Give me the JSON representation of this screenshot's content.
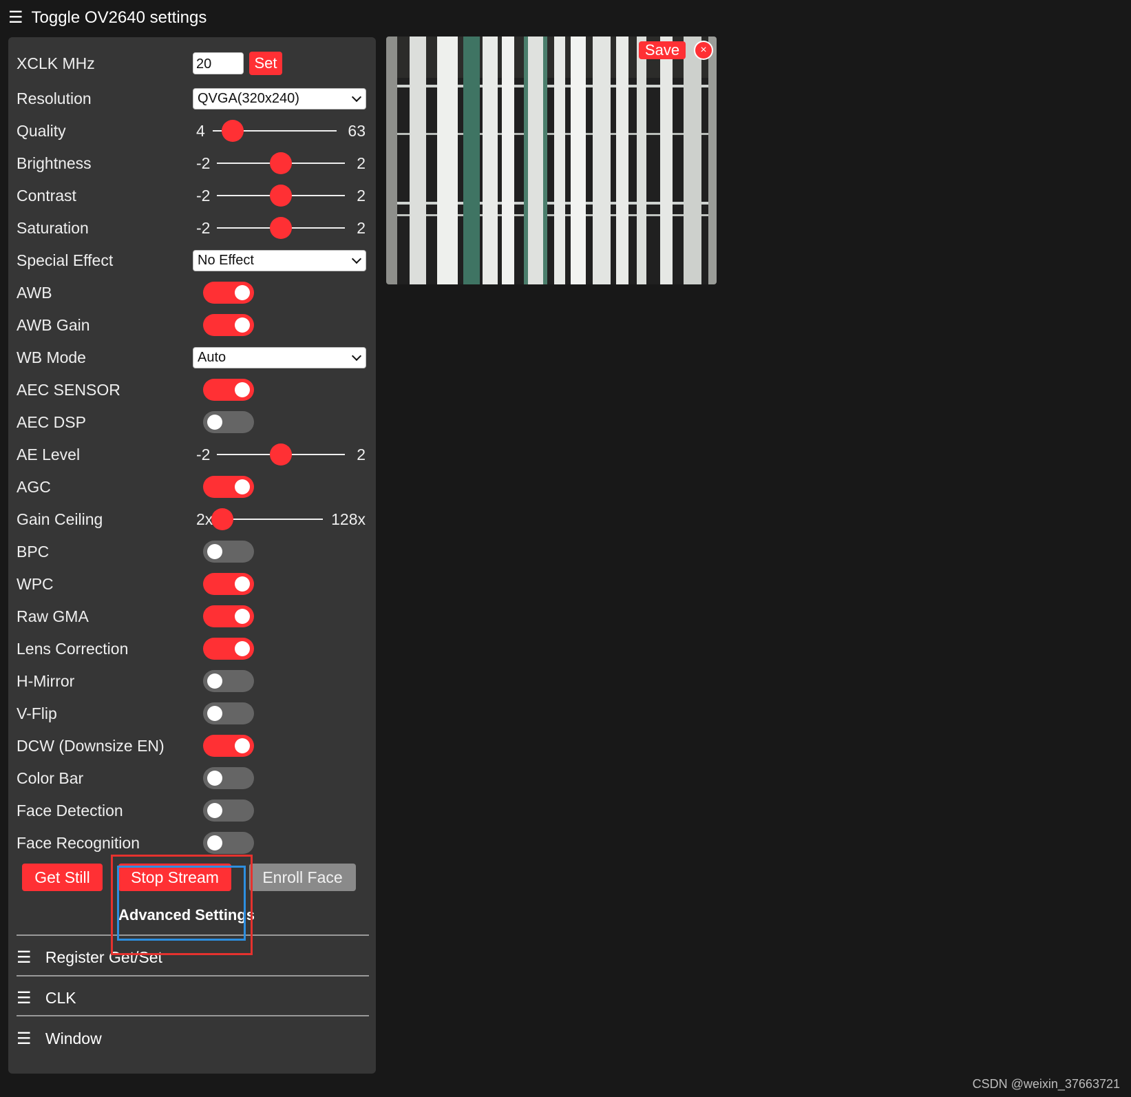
{
  "header": {
    "menu_icon": "☰",
    "title": "Toggle OV2640 settings"
  },
  "colors": {
    "accent": "#ff3034",
    "panel": "#363636",
    "background": "#181818",
    "toggle_off": "#656565"
  },
  "controls": {
    "xclk": {
      "label": "XCLK MHz",
      "value": "20",
      "button": "Set"
    },
    "resolution": {
      "label": "Resolution",
      "selected": "QVGA(320x240)"
    },
    "quality": {
      "label": "Quality",
      "min": "4",
      "max": "63",
      "level": 0.16
    },
    "brightness": {
      "label": "Brightness",
      "min": "-2",
      "max": "2",
      "level": 0.5
    },
    "contrast": {
      "label": "Contrast",
      "min": "-2",
      "max": "2",
      "level": 0.5
    },
    "saturation": {
      "label": "Saturation",
      "min": "-2",
      "max": "2",
      "level": 0.5
    },
    "special_effect": {
      "label": "Special Effect",
      "selected": "No Effect"
    },
    "awb": {
      "label": "AWB",
      "on": true
    },
    "awb_gain": {
      "label": "AWB Gain",
      "on": true
    },
    "wb_mode": {
      "label": "WB Mode",
      "selected": "Auto"
    },
    "aec_sensor": {
      "label": "AEC SENSOR",
      "on": true
    },
    "aec_dsp": {
      "label": "AEC DSP",
      "on": false
    },
    "ae_level": {
      "label": "AE Level",
      "min": "-2",
      "max": "2",
      "level": 0.5
    },
    "agc": {
      "label": "AGC",
      "on": true
    },
    "gain_ceiling": {
      "label": "Gain Ceiling",
      "min": "2x",
      "max": "128x",
      "level": 0.0
    },
    "bpc": {
      "label": "BPC",
      "on": false
    },
    "wpc": {
      "label": "WPC",
      "on": true
    },
    "raw_gma": {
      "label": "Raw GMA",
      "on": true
    },
    "lens_correction": {
      "label": "Lens Correction",
      "on": true
    },
    "h_mirror": {
      "label": "H-Mirror",
      "on": false
    },
    "v_flip": {
      "label": "V-Flip",
      "on": false
    },
    "dcw": {
      "label": "DCW (Downsize EN)",
      "on": true
    },
    "color_bar": {
      "label": "Color Bar",
      "on": false
    },
    "face_detection": {
      "label": "Face Detection",
      "on": false
    },
    "face_recognition": {
      "label": "Face Recognition",
      "on": false
    }
  },
  "buttons": {
    "get_still": "Get Still",
    "stop_stream": "Stop Stream",
    "enroll_face": "Enroll Face"
  },
  "advanced": {
    "title": "Advanced Settings",
    "sections": [
      "Register Get/Set",
      "CLK",
      "Window"
    ]
  },
  "preview": {
    "save": "Save",
    "close_icon": "×"
  },
  "footer": {
    "watermark": "CSDN @weixin_37663721"
  }
}
